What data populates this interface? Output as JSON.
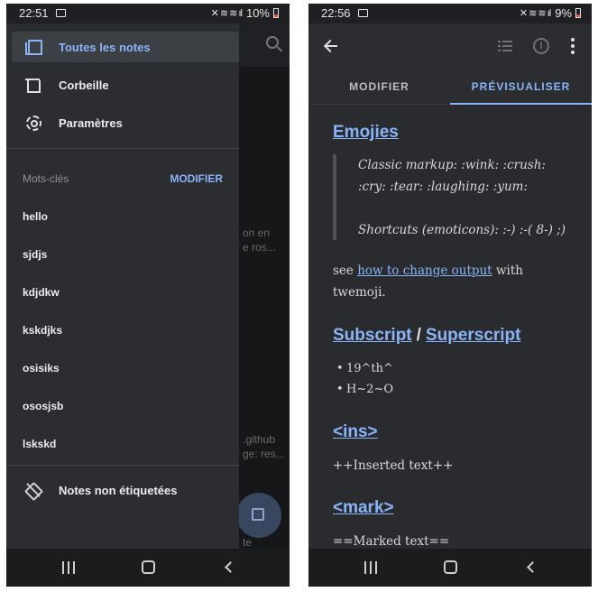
{
  "left_phone": {
    "status": {
      "time": "22:51",
      "signal": "✕‡≈…",
      "battery": "10%"
    },
    "background_app": {
      "snippets": [
        "on en",
        "e ros...",
        ".github",
        "ge: res...",
        "te"
      ]
    },
    "drawer": {
      "items": [
        {
          "label": "Toutes les notes",
          "icon": "notes-icon"
        },
        {
          "label": "Corbeille",
          "icon": "trash-icon"
        },
        {
          "label": "Paramètres",
          "icon": "gear-icon"
        }
      ],
      "tags_section": {
        "label": "Mots-clés",
        "action": "MODIFIER"
      },
      "tags": [
        "hello",
        "sjdjs",
        "kdjdkw",
        "kskdjks",
        "osisiks",
        "ososjsb",
        "lskskd"
      ],
      "untagged": {
        "label": "Notes non étiquetées",
        "icon": "untagged-icon"
      }
    }
  },
  "right_phone": {
    "status": {
      "time": "22:56",
      "battery": "9%"
    },
    "tabs": [
      {
        "label": "MODIFIER"
      },
      {
        "label": "PRÉVISUALISER"
      }
    ],
    "preview": {
      "emojies_heading": "Emojies",
      "quote_line1": "Classic markup: :wink: :crush: :cry: :tear: :laughing: :yum:",
      "quote_line2": "Shortcuts (emoticons): :-) :-( 8-) ;)",
      "see_prefix": "see ",
      "see_link": "how to change output",
      "see_suffix": " with twemoji.",
      "subscript_heading": "Subscript",
      "heading_separator": "/",
      "superscript_heading": "Superscript",
      "list_items": [
        "19^th^",
        "H~2~O"
      ],
      "ins_heading": "<ins>",
      "ins_text": "++Inserted text++",
      "mark_heading": "<mark>",
      "mark_text": "==Marked text=="
    }
  }
}
